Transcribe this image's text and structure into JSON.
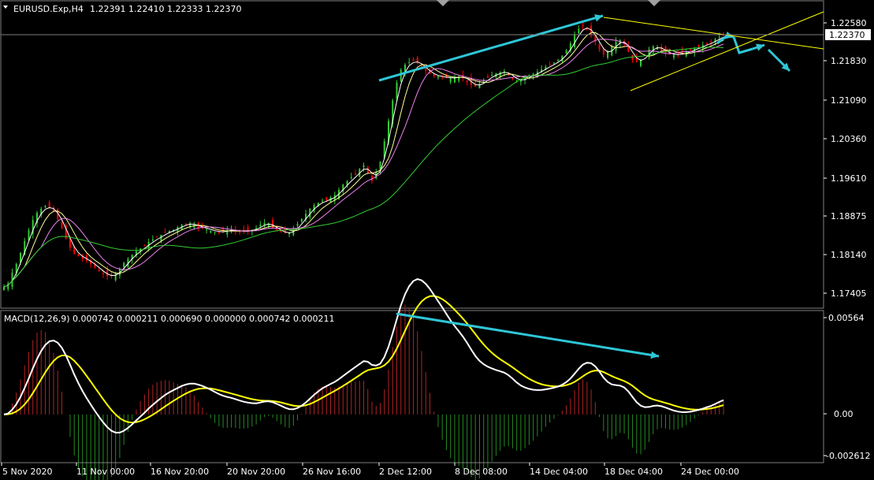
{
  "header": {
    "symbol": "EURUSD.Exp,H4",
    "ohlc": "1.22391 1.22410 1.22333 1.22370",
    "macd_label": "MACD(12,26,9) 0.000742 0.000211 0.000690 0.000000 0.000742 0.000211"
  },
  "price_axis": {
    "ticks": [
      "1.22580",
      "1.21830",
      "1.21090",
      "1.20360",
      "1.19610",
      "1.18875",
      "1.18140",
      "1.17405"
    ],
    "current": "1.22370"
  },
  "macd_axis": {
    "ticks": [
      "0.00564",
      "0.00",
      "-0.002612"
    ]
  },
  "time_axis": {
    "ticks": [
      "5 Nov 2020",
      "11 Nov 00:00",
      "16 Nov 20:00",
      "20 Nov 20:00",
      "26 Nov 16:00",
      "2 Dec 12:00",
      "8 Dec 08:00",
      "14 Dec 04:00",
      "18 Dec 04:00",
      "24 Dec 00:00"
    ]
  },
  "colors": {
    "background": "#000000",
    "bull": "#32cd32",
    "bear": "#ff0000",
    "ma_fast": "#ffffff",
    "ma_mid": "#ffff99",
    "ma_slow": "#ee82ee",
    "ma_long": "#32cd32",
    "macd_main": "#ffffff",
    "macd_signal": "#ffff00",
    "arrow": "#2ec6d6",
    "trendline": "#ffff00",
    "grid": "#808080"
  },
  "chart_data": [
    {
      "type": "candlestick",
      "ylim": [
        1.1705,
        1.2302
      ],
      "grid": false,
      "closes": [
        1.1745,
        1.1752,
        1.1773,
        1.179,
        1.1812,
        1.1835,
        1.1856,
        1.1876,
        1.189,
        1.1898,
        1.1903,
        1.19,
        1.1892,
        1.1878,
        1.186,
        1.184,
        1.1822,
        1.181,
        1.1805,
        1.18,
        1.1796,
        1.179,
        1.1783,
        1.1776,
        1.177,
        1.1766,
        1.1766,
        1.1772,
        1.178,
        1.1792,
        1.18,
        1.1808,
        1.1815,
        1.182,
        1.1826,
        1.1833,
        1.1838,
        1.1842,
        1.1847,
        1.1852,
        1.1855,
        1.1857,
        1.1862,
        1.1867,
        1.1868,
        1.1869,
        1.1866,
        1.1862,
        1.186,
        1.1858,
        1.1855,
        1.1853,
        1.1852,
        1.1854,
        1.1856,
        1.1857,
        1.1855,
        1.1853,
        1.1854,
        1.1855,
        1.1857,
        1.186,
        1.1867,
        1.187,
        1.1868,
        1.1861,
        1.1856,
        1.1852,
        1.185,
        1.1851,
        1.1858,
        1.1868,
        1.1878,
        1.1888,
        1.1898,
        1.1905,
        1.191,
        1.1914,
        1.1915,
        1.192,
        1.1925,
        1.1935,
        1.1945,
        1.1952,
        1.196,
        1.1967,
        1.1976,
        1.1983,
        1.1968,
        1.1953,
        1.197,
        1.199,
        1.203,
        1.207,
        1.211,
        1.2145,
        1.217,
        1.218,
        1.2185,
        1.2188,
        1.2183,
        1.2175,
        1.2168,
        1.2162,
        1.2158,
        1.2157,
        1.2156,
        1.2154,
        1.2153,
        1.2155,
        1.2157,
        1.2155,
        1.2147,
        1.214,
        1.2137,
        1.2143,
        1.215,
        1.2155,
        1.216,
        1.2163,
        1.2165,
        1.2167,
        1.216,
        1.2152,
        1.2148,
        1.215,
        1.2155,
        1.2158,
        1.2162,
        1.2166,
        1.2171,
        1.2176,
        1.218,
        1.2184,
        1.219,
        1.2198,
        1.2208,
        1.2222,
        1.2238,
        1.225,
        1.2255,
        1.225,
        1.224,
        1.2225,
        1.221,
        1.22,
        1.2205,
        1.2215,
        1.2225,
        1.2228,
        1.222,
        1.2205,
        1.219,
        1.2185,
        1.219,
        1.22,
        1.221,
        1.2216,
        1.2214,
        1.2208,
        1.2203,
        1.22,
        1.2199,
        1.22,
        1.2202,
        1.2205,
        1.2208,
        1.2212,
        1.2215,
        1.2218,
        1.2222,
        1.2224,
        1.223,
        1.2235,
        1.2237
      ],
      "series": [
        {
          "name": "",
          "kind": "ma_fast"
        },
        {
          "name": "",
          "kind": "ma_mid"
        },
        {
          "name": "",
          "kind": "ma_slow"
        },
        {
          "name": "",
          "kind": "ma_long"
        }
      ]
    },
    {
      "type": "line",
      "ylim": [
        -0.002612,
        0.00564
      ],
      "series": [
        {
          "name": "",
          "kind": "macd_main"
        },
        {
          "name": "",
          "kind": "macd_signal"
        },
        {
          "name": "",
          "kind": "osma_histogram"
        }
      ]
    }
  ]
}
